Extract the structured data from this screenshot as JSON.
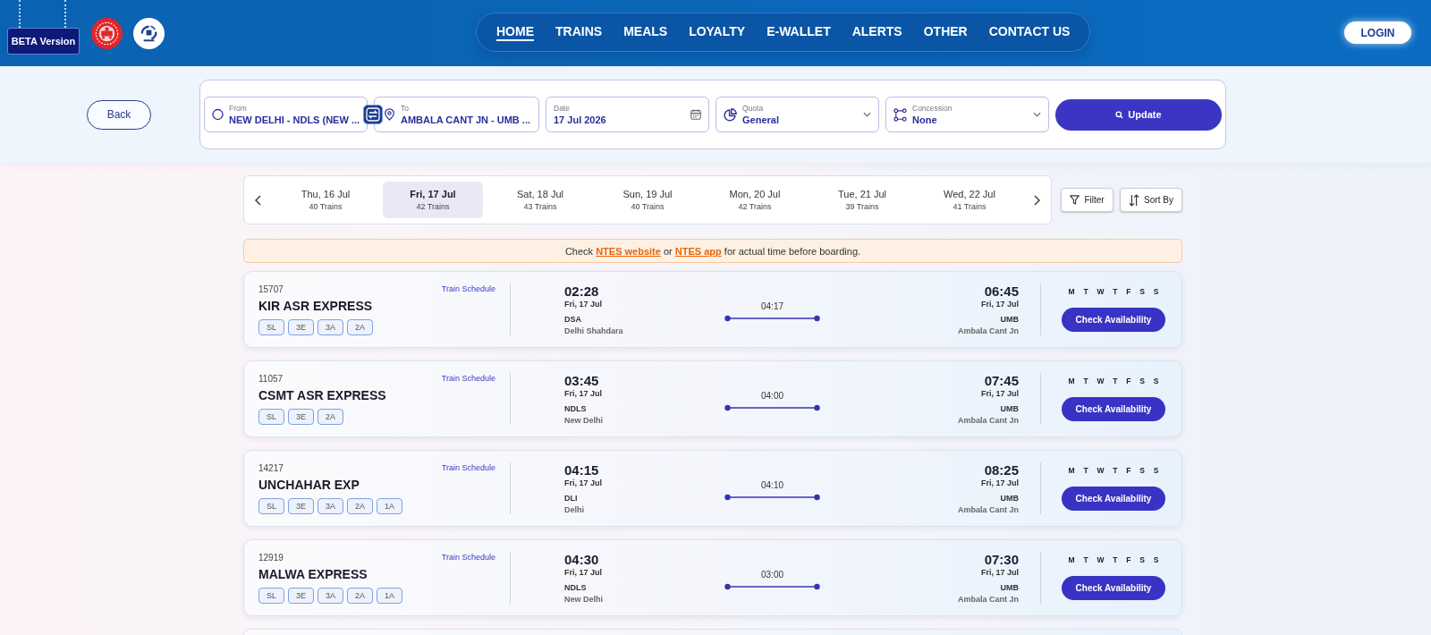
{
  "header": {
    "badge": "BETA Version",
    "nav": [
      {
        "label": "HOME",
        "selected": true
      },
      {
        "label": "TRAINS",
        "selected": false
      },
      {
        "label": "MEALS",
        "selected": false
      },
      {
        "label": "LOYALTY",
        "selected": false
      },
      {
        "label": "E-WALLET",
        "selected": false
      },
      {
        "label": "ALERTS",
        "selected": false
      },
      {
        "label": "OTHER",
        "selected": false
      },
      {
        "label": "CONTACT US",
        "selected": false
      }
    ],
    "login": "LOGIN"
  },
  "search": {
    "back": "Back",
    "fields": [
      {
        "kind": "origin",
        "label": "From",
        "value": "NEW DELHI - NDLS (NEW ..."
      },
      {
        "kind": "destination",
        "label": "To",
        "value": "AMBALA CANT JN - UMB ..."
      },
      {
        "kind": "date",
        "label": "Date",
        "value": "17 Jul 2026"
      },
      {
        "kind": "quota",
        "label": "Quota",
        "value": "General"
      },
      {
        "kind": "concession",
        "label": "Concession",
        "value": "None"
      }
    ],
    "update": "Update"
  },
  "dates": [
    {
      "day": "Thu, 16 Jul",
      "trains": "40 Trains",
      "selected": false
    },
    {
      "day": "Fri, 17 Jul",
      "trains": "42 Trains",
      "selected": true
    },
    {
      "day": "Sat, 18 Jul",
      "trains": "43 Trains",
      "selected": false
    },
    {
      "day": "Sun, 19 Jul",
      "trains": "40 Trains",
      "selected": false
    },
    {
      "day": "Mon, 20 Jul",
      "trains": "42 Trains",
      "selected": false
    },
    {
      "day": "Tue, 21 Jul",
      "trains": "39 Trains",
      "selected": false
    },
    {
      "day": "Wed, 22 Jul",
      "trains": "41 Trains",
      "selected": false
    }
  ],
  "filter": "Filter",
  "sort": "Sort By",
  "notice": [
    {
      "kind": "text",
      "text": "Check"
    },
    {
      "kind": "link",
      "text": "NTES website"
    },
    {
      "kind": "text",
      "text": "or"
    },
    {
      "kind": "link",
      "text": "NTES app"
    },
    {
      "kind": "text",
      "text": "for actual time before boarding."
    }
  ],
  "trains": [
    {
      "number": "15707",
      "name": "KIR ASR EXPRESS",
      "schedule": "Train Schedule",
      "classes": [
        "SL",
        "3E",
        "3A",
        "2A"
      ],
      "departure": {
        "time": "02:28",
        "date": "Fri, 17 Jul",
        "code": "DSA",
        "station": "Delhi Shahdara"
      },
      "duration": "04:17",
      "arrival": {
        "time": "06:45",
        "date": "Fri, 17 Jul",
        "code": "UMB",
        "station": "Ambala Cant Jn"
      },
      "days": [
        "M",
        "T",
        "W",
        "T",
        "F",
        "S",
        "S"
      ],
      "action": "Check Availability"
    },
    {
      "number": "11057",
      "name": "CSMT ASR EXPRESS",
      "schedule": "Train Schedule",
      "classes": [
        "SL",
        "3E",
        "2A"
      ],
      "departure": {
        "time": "03:45",
        "date": "Fri, 17 Jul",
        "code": "NDLS",
        "station": "New Delhi"
      },
      "duration": "04:00",
      "arrival": {
        "time": "07:45",
        "date": "Fri, 17 Jul",
        "code": "UMB",
        "station": "Ambala Cant Jn"
      },
      "days": [
        "M",
        "T",
        "W",
        "T",
        "F",
        "S",
        "S"
      ],
      "action": "Check Availability"
    },
    {
      "number": "14217",
      "name": "UNCHAHAR EXP",
      "schedule": "Train Schedule",
      "classes": [
        "SL",
        "3E",
        "3A",
        "2A",
        "1A"
      ],
      "departure": {
        "time": "04:15",
        "date": "Fri, 17 Jul",
        "code": "DLI",
        "station": "Delhi"
      },
      "duration": "04:10",
      "arrival": {
        "time": "08:25",
        "date": "Fri, 17 Jul",
        "code": "UMB",
        "station": "Ambala Cant Jn"
      },
      "days": [
        "M",
        "T",
        "W",
        "T",
        "F",
        "S",
        "S"
      ],
      "action": "Check Availability"
    },
    {
      "number": "12919",
      "name": "MALWA EXPRESS",
      "schedule": "Train Schedule",
      "classes": [
        "SL",
        "3E",
        "3A",
        "2A",
        "1A"
      ],
      "departure": {
        "time": "04:30",
        "date": "Fri, 17 Jul",
        "code": "NDLS",
        "station": "New Delhi"
      },
      "duration": "03:00",
      "arrival": {
        "time": "07:30",
        "date": "Fri, 17 Jul",
        "code": "UMB",
        "station": "Ambala Cant Jn"
      },
      "days": [
        "M",
        "T",
        "W",
        "T",
        "F",
        "S",
        "S"
      ],
      "action": "Check Availability"
    }
  ]
}
